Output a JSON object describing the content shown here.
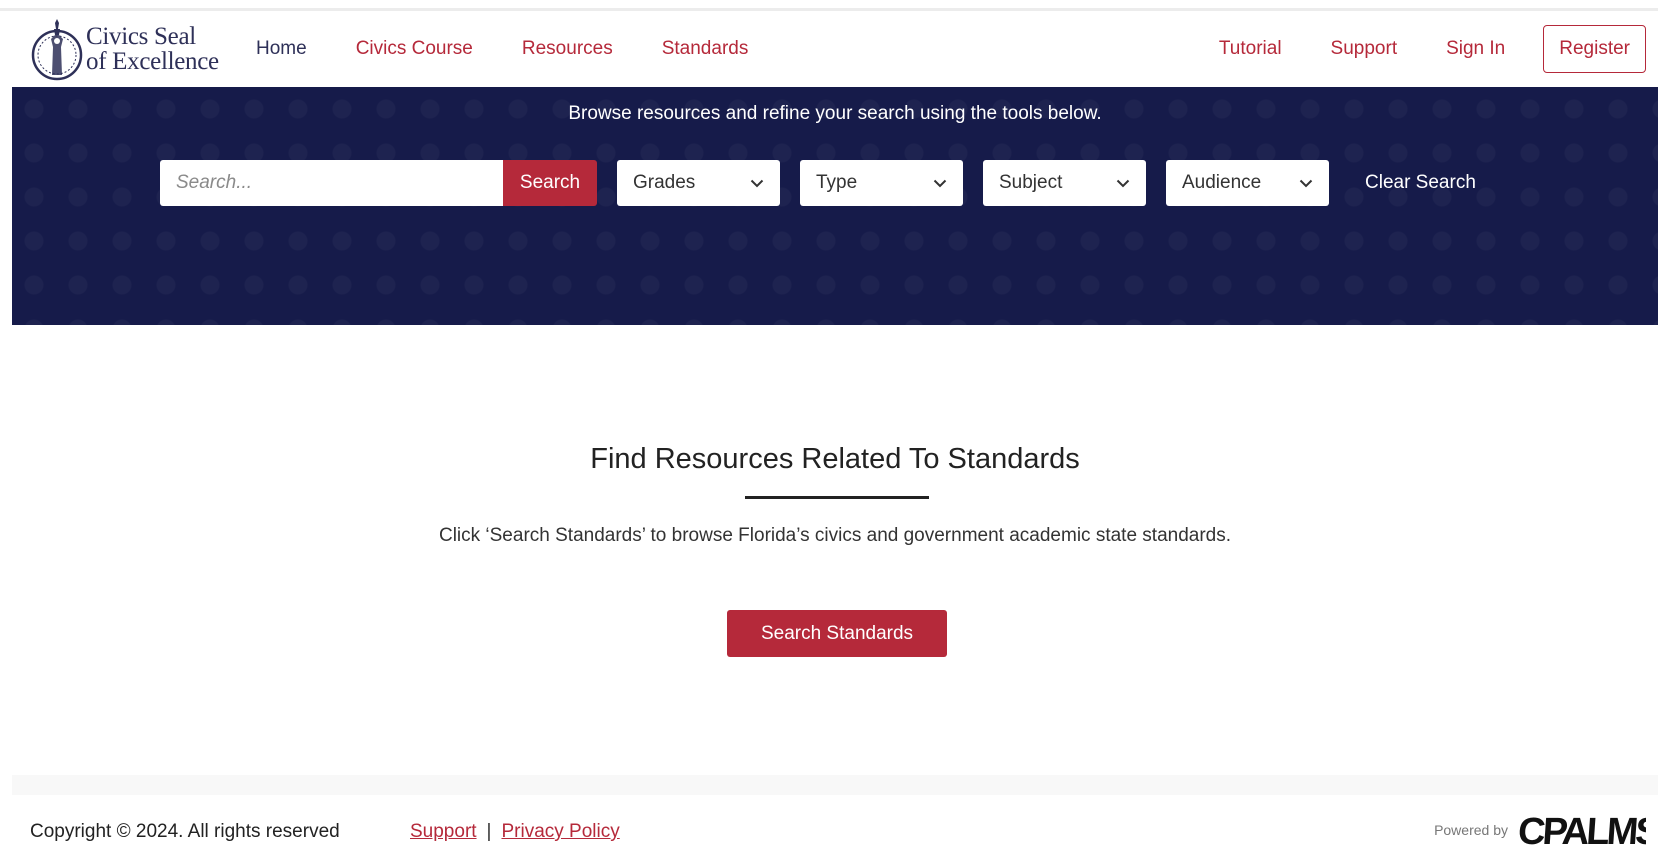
{
  "header": {
    "logo": {
      "line1": "Civics Seal",
      "line2": "of Excellence"
    },
    "nav_left": [
      {
        "label": "Home"
      },
      {
        "label": "Civics Course"
      },
      {
        "label": "Resources"
      },
      {
        "label": "Standards"
      }
    ],
    "nav_right": [
      {
        "label": "Tutorial"
      },
      {
        "label": "Support"
      },
      {
        "label": "Sign In"
      },
      {
        "label": "Register"
      }
    ]
  },
  "hero": {
    "tagline": "Browse resources and refine your search using the tools below.",
    "search": {
      "placeholder": "Search...",
      "button_label": "Search"
    },
    "filters": [
      {
        "label": "Grades"
      },
      {
        "label": "Type"
      },
      {
        "label": "Subject"
      },
      {
        "label": "Audience"
      }
    ],
    "clear_label": "Clear Search"
  },
  "main": {
    "title": "Find Resources Related To Standards",
    "description": "Click ‘Search Standards’ to browse Florida’s civics and government academic state standards.",
    "cta_label": "Search Standards"
  },
  "footer": {
    "copyright": "Copyright © 2024. All rights reserved",
    "links": [
      {
        "label": "Support"
      },
      {
        "label": "Privacy Policy"
      }
    ],
    "separator": "|",
    "powered_by": "Powered by",
    "brand_logo": "CPALMS"
  },
  "colors": {
    "brand_red": "#b5293a",
    "navy": "#161b4a",
    "logo_navy": "#2e3058"
  },
  "icons": {
    "seal": "liberty-seal-icon",
    "dropdown": "chevron-down-icon"
  }
}
